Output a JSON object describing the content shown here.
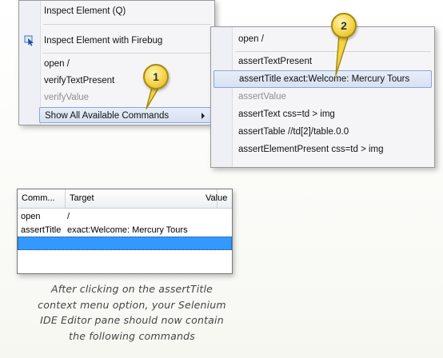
{
  "context_menu": {
    "items": [
      {
        "label": "Inspect Element (Q)"
      },
      {
        "label": "Inspect Element with Firebug",
        "icon": "firebug-icon"
      },
      {
        "label": "open /"
      },
      {
        "label": "verifyTextPresent"
      },
      {
        "label": "verifyValue",
        "disabled": true
      },
      {
        "label": "Show All Available Commands",
        "has_submenu": true,
        "highlighted": true
      }
    ]
  },
  "submenu": {
    "items": [
      {
        "label": "open /"
      },
      {
        "label": "assertTextPresent"
      },
      {
        "label": "assertTitle exact:Welcome: Mercury Tours",
        "highlighted": true
      },
      {
        "label": "assertValue",
        "disabled": true
      },
      {
        "label": "assertText css=td > img"
      },
      {
        "label": "assertTable //td[2]/table.0.0"
      },
      {
        "label": "assertElementPresent css=td > img"
      }
    ]
  },
  "callouts": {
    "one": "1",
    "two": "2"
  },
  "editor": {
    "columns": {
      "command": "Comm...",
      "target": "Target",
      "value": "Value"
    },
    "rows": [
      {
        "command": "open",
        "target": "/",
        "value": ""
      },
      {
        "command": "assertTitle",
        "target": "exact:Welcome: Mercury Tours",
        "value": ""
      }
    ]
  },
  "caption": {
    "lines": [
      "After clicking on the assertTitle",
      "context menu option, your Selenium",
      "IDE Editor pane should now contain",
      "the following commands"
    ]
  },
  "colors": {
    "selection_blue": "#3399ff",
    "callout_yellow": "#f3d447",
    "menu_highlight": "#d5e1f3"
  }
}
